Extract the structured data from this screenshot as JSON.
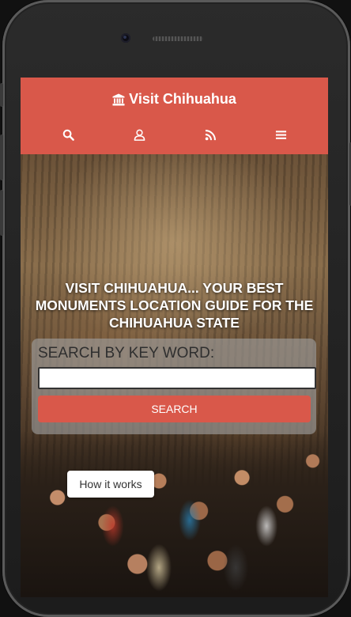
{
  "header": {
    "brand_title": "Visit Chihuahua",
    "brand_icon": "bank-icon",
    "background_color": "#d9584a",
    "nav": [
      {
        "id": "search",
        "icon": "search-icon"
      },
      {
        "id": "user",
        "icon": "user-icon"
      },
      {
        "id": "rss",
        "icon": "rss-icon"
      },
      {
        "id": "menu",
        "icon": "hamburger-menu-icon"
      }
    ]
  },
  "hero": {
    "headline": "VISIT CHIHUAHUA... YOUR BEST MONUMENTS LOCATION GUIDE FOR THE CHIHUAHUA STATE"
  },
  "search": {
    "label": "SEARCH BY KEY WORD:",
    "input_value": "",
    "button_label": "SEARCH"
  },
  "how_it_works": {
    "label": "How it works"
  }
}
